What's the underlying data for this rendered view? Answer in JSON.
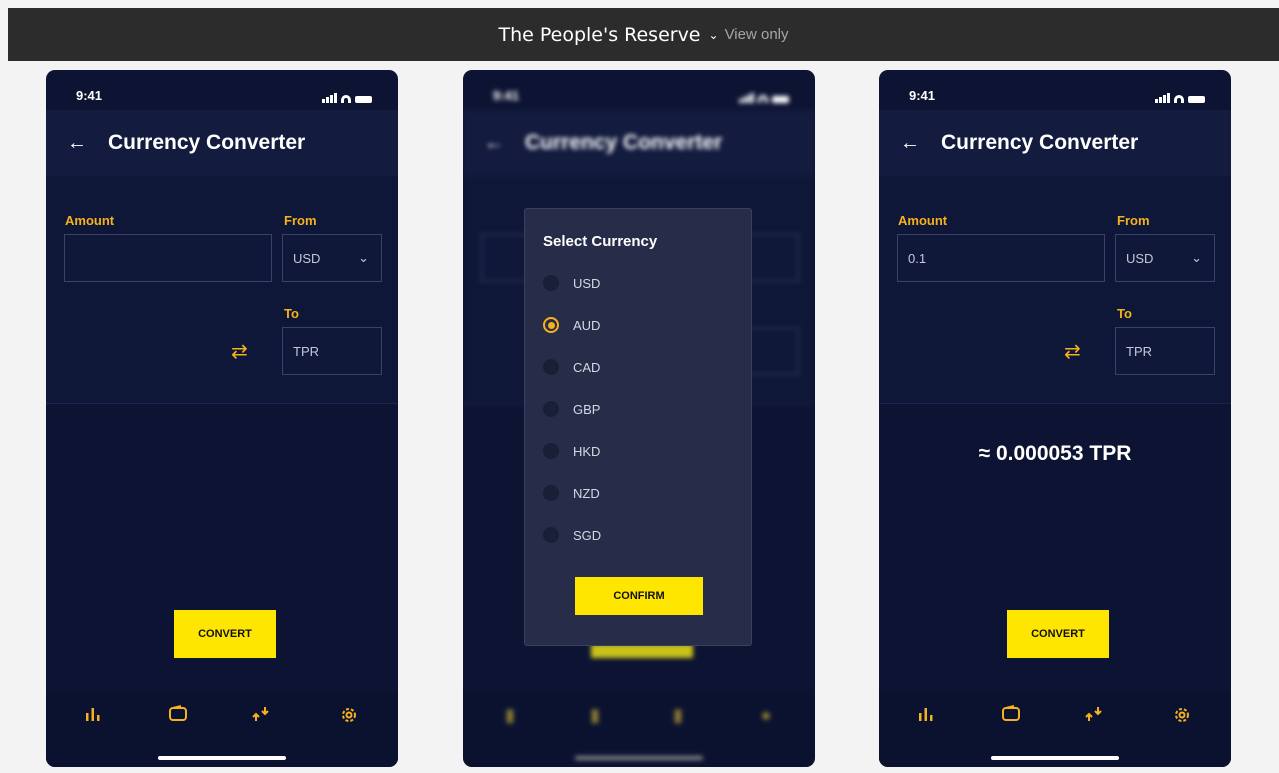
{
  "topbar": {
    "title": "The People's Reserve",
    "chevron": "⌄",
    "subtitle": "View only"
  },
  "screens": [
    {
      "status_time": "9:41",
      "title": "Currency Converter",
      "back": "←",
      "amount_label": "Amount",
      "amount_value": "",
      "from_label": "From",
      "from_value": "USD",
      "to_label": "To",
      "to_value": "TPR",
      "convert_label": "CONVERT"
    },
    {
      "status_time": "9:41",
      "title": "Currency Converter",
      "back": "←",
      "modal_title": "Select Currency",
      "options": [
        "USD",
        "AUD",
        "CAD",
        "GBP",
        "HKD",
        "NZD",
        "SGD"
      ],
      "selected": "AUD",
      "confirm_label": "CONFIRM"
    },
    {
      "status_time": "9:41",
      "title": "Currency Converter",
      "back": "←",
      "amount_label": "Amount",
      "amount_value": "0.1",
      "from_label": "From",
      "from_value": "USD",
      "to_label": "To",
      "to_value": "TPR",
      "result": "≈ 0.000053 TPR",
      "convert_label": "CONVERT"
    }
  ],
  "icons": {
    "swap": "⇄",
    "dropdown": "⌄",
    "nav": [
      "chart-icon",
      "wallet-icon",
      "transfer-icon",
      "settings-icon"
    ]
  },
  "colors": {
    "background": "#0d1433",
    "accent": "#f5b21c",
    "button": "#ffe600"
  }
}
